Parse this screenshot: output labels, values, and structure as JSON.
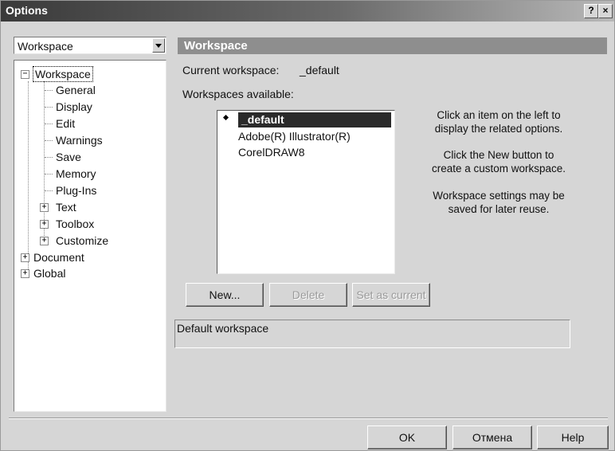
{
  "window": {
    "title": "Options",
    "help_btn": "?",
    "close_btn": "×"
  },
  "left": {
    "combo_value": "Workspace",
    "tree": [
      {
        "label": "Workspace",
        "level": 0,
        "expander": "−",
        "selected": true
      },
      {
        "label": "General",
        "level": 1
      },
      {
        "label": "Display",
        "level": 1
      },
      {
        "label": "Edit",
        "level": 1
      },
      {
        "label": "Warnings",
        "level": 1
      },
      {
        "label": "Save",
        "level": 1
      },
      {
        "label": "Memory",
        "level": 1
      },
      {
        "label": "Plug-Ins",
        "level": 1
      },
      {
        "label": "Text",
        "level": 1,
        "expander": "+"
      },
      {
        "label": "Toolbox",
        "level": 1,
        "expander": "+"
      },
      {
        "label": "Customize",
        "level": 1,
        "expander": "+"
      },
      {
        "label": "Document",
        "level": 0,
        "expander": "+"
      },
      {
        "label": "Global",
        "level": 0,
        "expander": "+"
      }
    ]
  },
  "panel": {
    "header": "Workspace",
    "current_label": "Current workspace:",
    "current_value": "_default",
    "available_label": "Workspaces available:",
    "workspaces": [
      "_default",
      "Adobe(R) Illustrator(R)",
      "CorelDRAW8"
    ],
    "help_text": [
      "Click an item on the left to",
      "display the related options.",
      "",
      "Click the New button to",
      "create a custom workspace.",
      "",
      "Workspace settings may be",
      "saved for later reuse."
    ],
    "buttons": {
      "new": "New...",
      "delete": "Delete",
      "set_current": "Set as current"
    },
    "description": "Default workspace"
  },
  "footer": {
    "ok": "OK",
    "cancel": "Отмена",
    "help": "Help"
  }
}
